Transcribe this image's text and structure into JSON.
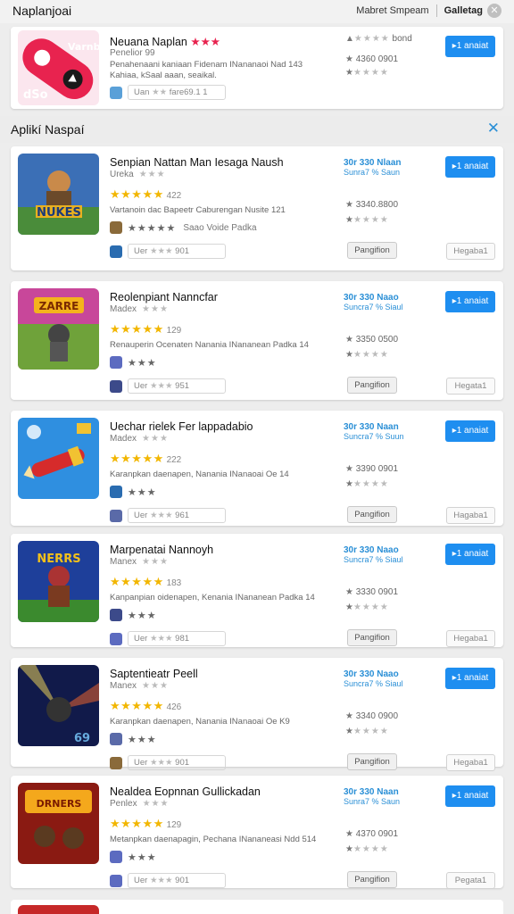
{
  "topbar": {
    "title": "Naplanjoai",
    "right_label": "Mabret Smpeam",
    "gallery_label": "Galletag",
    "close_glyph": "✕"
  },
  "featured": {
    "name": "Neuana Naplan",
    "name_stars": "★★★",
    "subtitle": "Penelior 99",
    "desc1": "Penahenaani kaniaan Fidenam INananaoi Nad 143",
    "desc2": "Kahiaa, kSaal aaan, seaikal.",
    "pill_text": "Uan",
    "pill_stars": "★★",
    "pill_num": "fare69.1 1",
    "stat1_prefix": "▲",
    "stat1_stars": "★★★★",
    "stat1_text": "bond",
    "stat2_star": "★",
    "stat2_text": "4360 0901",
    "stat3_dark": "★",
    "stat3_stars": "★★★★",
    "install_label": "▸1 anaiat",
    "icon_text": "Varnbis",
    "icon_text2": "dSo"
  },
  "section": {
    "label": "Aplikí Naspaí",
    "close_glyph": "✕"
  },
  "apps": [
    {
      "name": "Senpian Nattan Man Iesaga Naush",
      "dev": "Ureka",
      "dev_stars": "★★★",
      "rating_stars": "★★★★★",
      "rating_count": "422",
      "desc": "Vartanoin dac Bapeetr Caburengan Nusite 121",
      "row2_stars": "★★★★★",
      "row2_text": "Saao Voide Padka",
      "pill_text": "Uer",
      "pill_stars": "★★★",
      "pill_num": "901",
      "promo1": "30r 330 Nlaan",
      "promo2": "Sunra7 % Saun",
      "stat1": "3340.8800",
      "stat2_stars": "★★★★",
      "install_label": "▸1 anaiat",
      "secondary_label": "Pangifion",
      "tertiary_label": "Hegaba1",
      "icon_text": "NUKES"
    },
    {
      "name": "Reolenpiant Nanncfar",
      "dev": "Madex",
      "dev_stars": "★★★",
      "rating_stars": "★★★★★",
      "rating_count": "129",
      "desc": "Renauperin Ocenaten Nanania INananean Padka 14",
      "row2_stars": "★★★",
      "row2_text": "",
      "pill_text": "Uer",
      "pill_stars": "★★★",
      "pill_num": "951",
      "promo1": "30r 330 Naao",
      "promo2": "Suncra7 % Siaul",
      "stat1": "3350 0500",
      "stat2_stars": "★★★★",
      "install_label": "▸1 anaiat",
      "secondary_label": "Pangifion",
      "tertiary_label": "Hegata1",
      "icon_text": "ZARRE"
    },
    {
      "name": "Uechar rielek Fer lappadabio",
      "dev": "Madex",
      "dev_stars": "★★★",
      "rating_stars": "★★★★★",
      "rating_count": "222",
      "desc": "Karanpkan daenapen, Nanania INanaoai Oe 14",
      "row2_stars": "★★★",
      "row2_text": "",
      "pill_text": "Uer",
      "pill_stars": "★★★",
      "pill_num": "961",
      "promo1": "30r 330 Naan",
      "promo2": "Suncra7 % Suun",
      "stat1": "3390 0901",
      "stat2_stars": "★★★★",
      "install_label": "▸1 anaiat",
      "secondary_label": "Pangifion",
      "tertiary_label": "Hagaba1",
      "icon_text": ""
    },
    {
      "name": "Marpenatai Nannoyh",
      "dev": "Manex",
      "dev_stars": "★★★",
      "rating_stars": "★★★★★",
      "rating_count": "183",
      "desc": "Kanpanpian oidenapen, Kenania INananean Padka 14",
      "row2_stars": "★★★",
      "row2_text": "",
      "pill_text": "Uer",
      "pill_stars": "★★★",
      "pill_num": "981",
      "promo1": "30r 330 Naao",
      "promo2": "Suncra7 % Siaul",
      "stat1": "3330 0901",
      "stat2_stars": "★★★★",
      "install_label": "▸1 anaiat",
      "secondary_label": "Pangifion",
      "tertiary_label": "Hegaba1",
      "icon_text": "NERRS"
    },
    {
      "name": "Saptentieatr Peell",
      "dev": "Manex",
      "dev_stars": "★★★",
      "rating_stars": "★★★★★",
      "rating_count": "426",
      "desc": "Karanpkan daenapen, Nanania INanaoai Oe K9",
      "row2_stars": "★★★",
      "row2_text": "",
      "pill_text": "Uer",
      "pill_stars": "★★★",
      "pill_num": "901",
      "promo1": "30r 330 Naao",
      "promo2": "Suncra7 % Siaul",
      "stat1": "3340 0900",
      "stat2_stars": "★★★★",
      "install_label": "▸1 anaiat",
      "secondary_label": "Pangifion",
      "tertiary_label": "Hegaba1",
      "icon_text": "69"
    },
    {
      "name": "Nealdea Eopnnan Gullickadan",
      "dev": "Penlex",
      "dev_stars": "★★★",
      "rating_stars": "★★★★★",
      "rating_count": "129",
      "desc": "Metanpkan daenapagin, Pechana INananeasi Ndd 514",
      "row2_stars": "★★★",
      "row2_text": "",
      "pill_text": "Uer",
      "pill_stars": "★★★",
      "pill_num": "901",
      "promo1": "30r 330 Naan",
      "promo2": "Sunra7 % Saun",
      "stat1": "4370 0901",
      "stat2_stars": "★★★★",
      "install_label": "▸1 anaiat",
      "secondary_label": "Pangifion",
      "tertiary_label": "Pegata1",
      "icon_text": "DRNERS"
    }
  ]
}
